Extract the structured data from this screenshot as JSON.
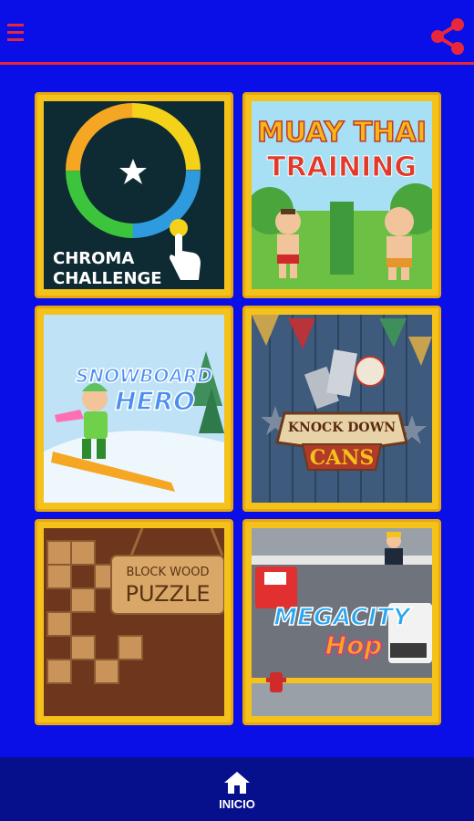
{
  "colors": {
    "background": "#0a0fe8",
    "accent": "#e8283a",
    "tile_border": "#f4c21a",
    "nav_bg": "#07108c"
  },
  "header": {
    "menu_icon": "hamburger-icon",
    "share_icon": "share-icon"
  },
  "games": [
    {
      "id": "chroma",
      "title_line1": "CHROMA",
      "title_line2": "CHALLENGE"
    },
    {
      "id": "muaythai",
      "title_line1": "MUAY THAI",
      "title_line2": "TRAINING"
    },
    {
      "id": "snowboard",
      "title_line1": "SNOWBOARD",
      "title_line2": "HERO"
    },
    {
      "id": "cans",
      "title_line1": "KNOCK DOWN",
      "title_line2": "CANS"
    },
    {
      "id": "blockwood",
      "title_line1": "BLOCK WOOD",
      "title_line2": "PUZZLE"
    },
    {
      "id": "megacity",
      "title_line1": "MEGACITY",
      "title_line2": "Hop"
    }
  ],
  "bottom_nav": {
    "home_label": "INICIO",
    "home_icon": "home-icon"
  }
}
